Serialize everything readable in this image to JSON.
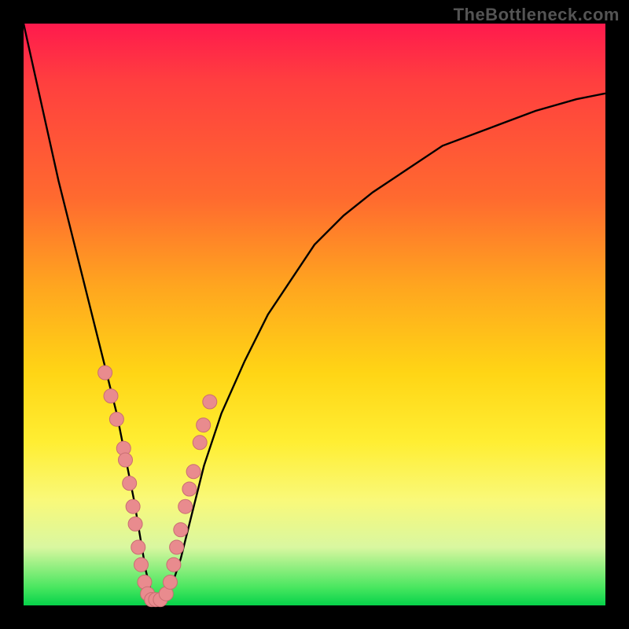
{
  "watermark": "TheBottleneck.com",
  "colors": {
    "frame": "#000000",
    "curve": "#000000",
    "marker_fill": "#e98b8e",
    "marker_stroke": "#c96e72",
    "gradient_stops": [
      "#ff1a4d",
      "#ff3f3f",
      "#ff6a2f",
      "#ffa51f",
      "#ffd515",
      "#ffee33",
      "#f9f97a",
      "#d9f7a0",
      "#47e65f",
      "#06d24a"
    ]
  },
  "chart_data": {
    "type": "line",
    "title": "",
    "xlabel": "",
    "ylabel": "",
    "xlim": [
      0,
      100
    ],
    "ylim": [
      0,
      100
    ],
    "x": [
      0,
      2,
      4,
      6,
      8,
      10,
      12,
      14,
      16,
      18,
      19,
      20,
      21,
      22,
      23,
      24,
      25,
      27,
      29,
      31,
      34,
      38,
      42,
      46,
      50,
      55,
      60,
      66,
      72,
      80,
      88,
      95,
      100
    ],
    "values": [
      100,
      91,
      82,
      73,
      65,
      57,
      49,
      41,
      33,
      23,
      18,
      12,
      6,
      2,
      0,
      0,
      2,
      8,
      16,
      24,
      33,
      42,
      50,
      56,
      62,
      67,
      71,
      75,
      79,
      82,
      85,
      87,
      88
    ],
    "markers": {
      "x": [
        14.0,
        15.0,
        16.0,
        17.2,
        17.5,
        18.2,
        18.8,
        19.2,
        19.7,
        20.2,
        20.8,
        21.3,
        22.0,
        22.7,
        23.5,
        24.5,
        25.2,
        25.8,
        26.3,
        27.0,
        27.8,
        28.5,
        29.2,
        30.3,
        30.9,
        32.0
      ],
      "y": [
        40,
        36,
        32,
        27,
        25,
        21,
        17,
        14,
        10,
        7,
        4,
        2,
        1,
        1,
        1,
        2,
        4,
        7,
        10,
        13,
        17,
        20,
        23,
        28,
        31,
        35
      ]
    }
  }
}
